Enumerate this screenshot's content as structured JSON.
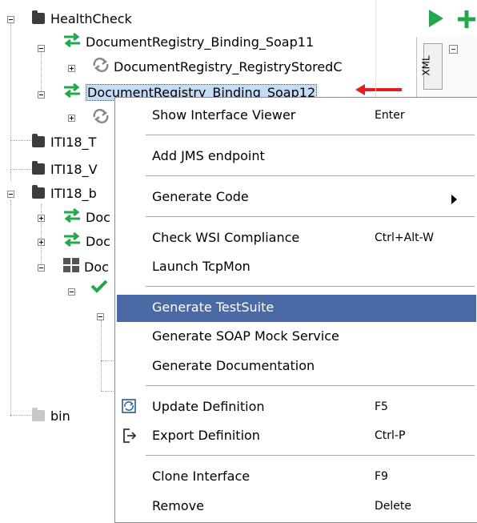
{
  "tree": {
    "root_label": "HealthCheck",
    "binding_soap11": "DocumentRegistry_Binding_Soap11",
    "stored_query": "DocumentRegistry_RegistryStoredC",
    "binding_soap12": "DocumentRegistry_Binding_Soap12",
    "iti18_t": "ITI18_T",
    "iti18_v": "ITI18_V",
    "iti18_b": "ITI18_b",
    "doc_1": "Doc",
    "doc_2": "Doc",
    "doc_3": "Doc",
    "bin": "bin"
  },
  "right_panel": {
    "xml_tab": "XML"
  },
  "context_menu": {
    "items": [
      {
        "label": "Show Interface Viewer",
        "shortcut": "Enter"
      },
      {
        "label": "Add JMS endpoint",
        "shortcut": ""
      },
      {
        "label": "Generate Code",
        "shortcut": ""
      },
      {
        "label": "Check WSI Compliance",
        "shortcut": "Ctrl+Alt-W"
      },
      {
        "label": "Launch TcpMon",
        "shortcut": ""
      },
      {
        "label": "Generate TestSuite",
        "shortcut": ""
      },
      {
        "label": "Generate SOAP Mock Service",
        "shortcut": ""
      },
      {
        "label": "Generate Documentation",
        "shortcut": ""
      },
      {
        "label": "Update Definition",
        "shortcut": "F5"
      },
      {
        "label": "Export Definition",
        "shortcut": "Ctrl-P"
      },
      {
        "label": "Clone Interface",
        "shortcut": "F9"
      },
      {
        "label": "Remove",
        "shortcut": "Delete"
      }
    ]
  },
  "colors": {
    "selection_highlight": "#4a6aa5",
    "arrow_red": "#e02020",
    "binding_green": "#22a84a"
  }
}
